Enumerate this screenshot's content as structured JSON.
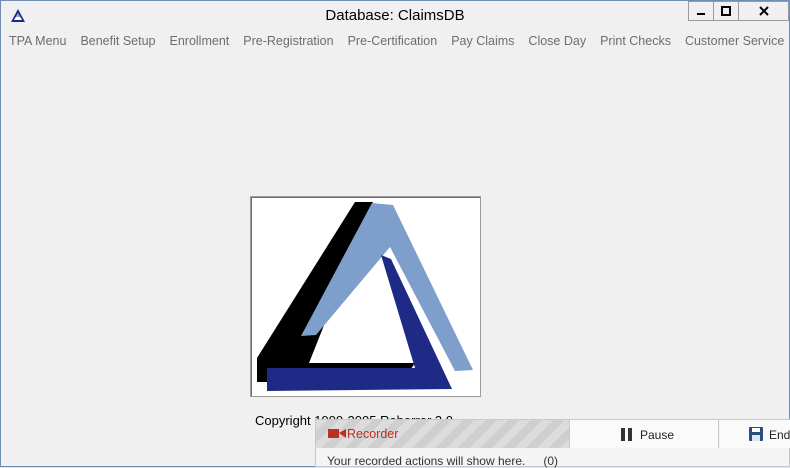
{
  "window": {
    "title": "Database: ClaimsDB"
  },
  "menu": {
    "items": [
      {
        "label": "TPA Menu"
      },
      {
        "label": "Benefit Setup"
      },
      {
        "label": "Enrollment"
      },
      {
        "label": "Pre-Registration"
      },
      {
        "label": "Pre-Certification"
      },
      {
        "label": "Pay Claims"
      },
      {
        "label": "Close Day"
      },
      {
        "label": "Print Checks"
      },
      {
        "label": "Customer Service"
      }
    ]
  },
  "main": {
    "copyright": "Copyright 1999-2005 Roberrer 3.0"
  },
  "recorder": {
    "label": "Recorder",
    "pause_label": "Pause",
    "end_label": "End",
    "status_text": "Your recorded actions will show here.",
    "count": "(0)"
  },
  "colors": {
    "logo_black": "#000000",
    "logo_light_blue": "#7e9fcb",
    "logo_dark_blue": "#1f2a86",
    "recorder_red": "#b8321f"
  },
  "icons": {
    "app": "triangle-logo-icon",
    "minimize": "minimize-icon",
    "maximize": "maximize-icon",
    "close": "close-icon",
    "record": "video-camera-icon",
    "pause": "pause-icon",
    "end": "save-icon"
  }
}
